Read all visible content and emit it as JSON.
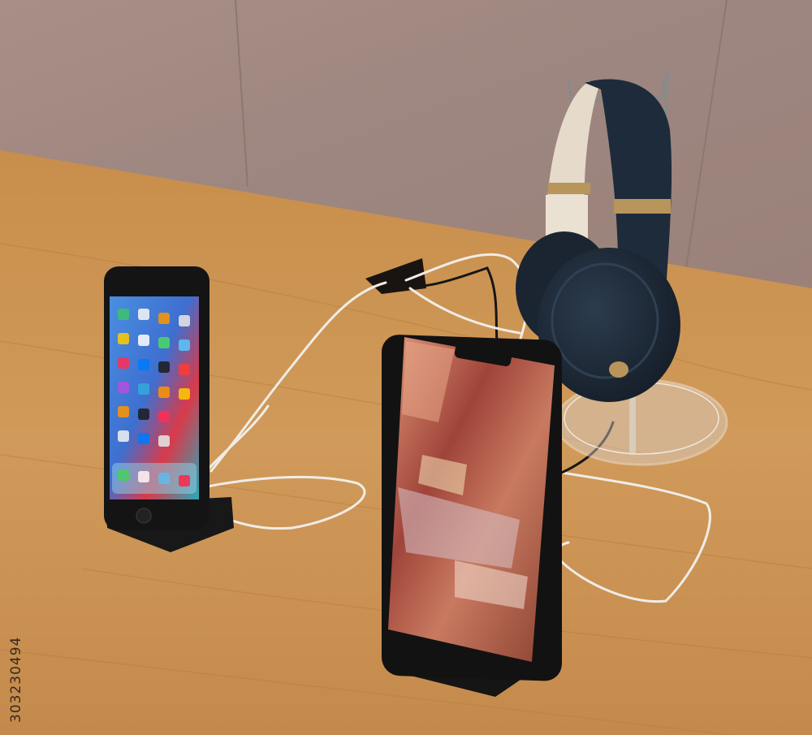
{
  "stock_id": "303230494",
  "colors": {
    "wall": "#a08880",
    "table": "#c9914f",
    "headphone_navy": "#1f2c3a",
    "headband_cream": "#e8dccd",
    "gold_accent": "#b8955a",
    "dock_black": "#1a1a1a"
  },
  "icons": [
    "iphone-8",
    "iphone-xs",
    "beats-studio3-headphones",
    "headphone-stand",
    "charging-dock"
  ]
}
